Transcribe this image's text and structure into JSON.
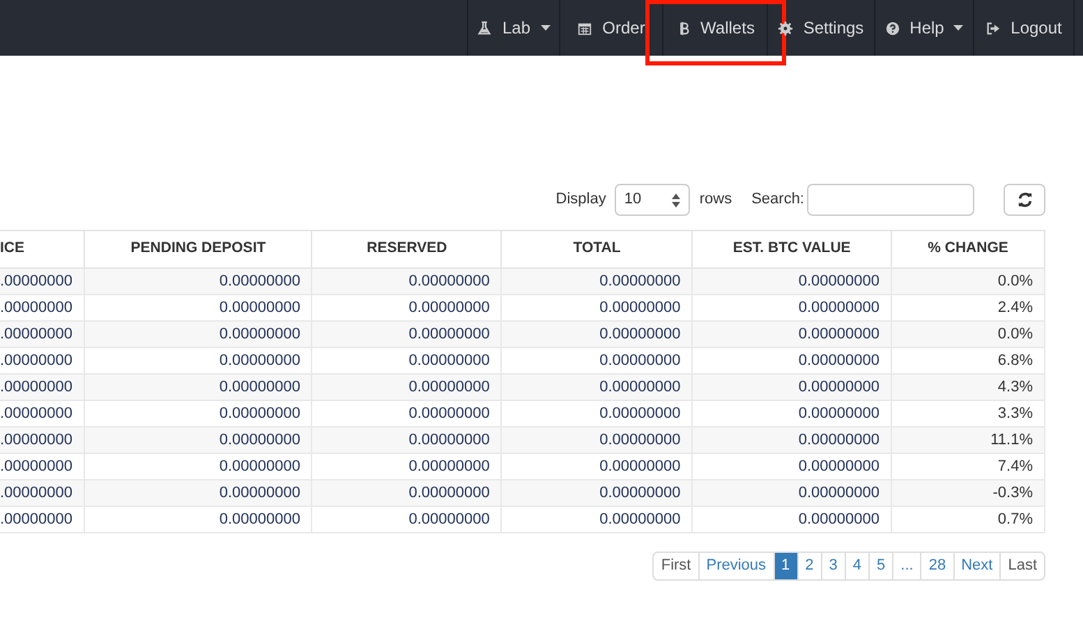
{
  "navbar": {
    "items": [
      {
        "label": "Lab",
        "dropdown": true,
        "highlighted": false
      },
      {
        "label": "Order",
        "dropdown": false,
        "highlighted": false
      },
      {
        "label": "Wallets",
        "dropdown": false,
        "highlighted": true
      },
      {
        "label": "Settings",
        "dropdown": false,
        "highlighted": false
      },
      {
        "label": "Help",
        "dropdown": true,
        "highlighted": false
      },
      {
        "label": "Logout",
        "dropdown": false,
        "highlighted": false
      }
    ]
  },
  "controls": {
    "display_label": "Display",
    "rows_value": "10",
    "rows_label": "rows",
    "search_label": "Search:"
  },
  "table": {
    "columns": [
      "ICE",
      "PENDING DEPOSIT",
      "RESERVED",
      "TOTAL",
      "EST. BTC VALUE",
      "% CHANGE"
    ],
    "rows": [
      [
        ".00000000",
        "0.00000000",
        "0.00000000",
        "0.00000000",
        "0.00000000",
        "0.0%"
      ],
      [
        ".00000000",
        "0.00000000",
        "0.00000000",
        "0.00000000",
        "0.00000000",
        "2.4%"
      ],
      [
        ".00000000",
        "0.00000000",
        "0.00000000",
        "0.00000000",
        "0.00000000",
        "0.0%"
      ],
      [
        ".00000000",
        "0.00000000",
        "0.00000000",
        "0.00000000",
        "0.00000000",
        "6.8%"
      ],
      [
        ".00000000",
        "0.00000000",
        "0.00000000",
        "0.00000000",
        "0.00000000",
        "4.3%"
      ],
      [
        ".00000000",
        "0.00000000",
        "0.00000000",
        "0.00000000",
        "0.00000000",
        "3.3%"
      ],
      [
        ".00000000",
        "0.00000000",
        "0.00000000",
        "0.00000000",
        "0.00000000",
        "11.1%"
      ],
      [
        ".00000000",
        "0.00000000",
        "0.00000000",
        "0.00000000",
        "0.00000000",
        "7.4%"
      ],
      [
        ".00000000",
        "0.00000000",
        "0.00000000",
        "0.00000000",
        "0.00000000",
        "-0.3%"
      ],
      [
        ".00000000",
        "0.00000000",
        "0.00000000",
        "0.00000000",
        "0.00000000",
        "0.7%"
      ]
    ]
  },
  "pagination": [
    {
      "label": "First",
      "selected": false
    },
    {
      "label": "Previous",
      "selected": false
    },
    {
      "label": "1",
      "selected": true
    },
    {
      "label": "2",
      "selected": false
    },
    {
      "label": "3",
      "selected": false
    },
    {
      "label": "4",
      "selected": false
    },
    {
      "label": "5",
      "selected": false
    },
    {
      "label": "...",
      "selected": false
    },
    {
      "label": "28",
      "selected": false
    },
    {
      "label": "Next",
      "selected": false
    },
    {
      "label": "Last",
      "selected": false
    }
  ]
}
